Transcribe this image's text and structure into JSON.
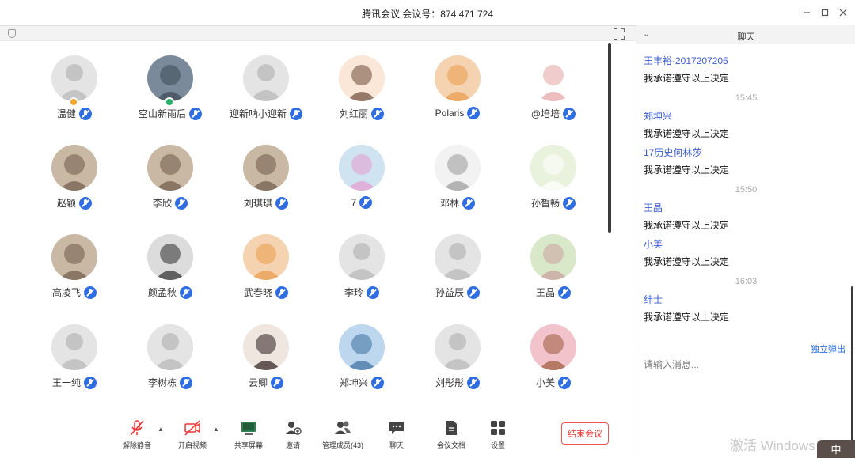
{
  "window": {
    "title": "腾讯会议 会议号：874 471 724",
    "controls": [
      "minimize-icon",
      "maximize-icon",
      "close-icon"
    ]
  },
  "participants": [
    {
      "name": "温健",
      "avatar": "default-avatar",
      "badge": "host"
    },
    {
      "name": "空山新雨后",
      "avatar": "city-photo",
      "badge": "green"
    },
    {
      "name": "迎新呐小迎新",
      "avatar": "default-avatar"
    },
    {
      "name": "刘红丽",
      "avatar": "cartoon-kid"
    },
    {
      "name": "Polaris",
      "avatar": "anime-girl"
    },
    {
      "name": "@培培",
      "avatar": "cartoon-sketch"
    },
    {
      "name": "赵颖",
      "avatar": "cat-photo"
    },
    {
      "name": "李欣",
      "avatar": "cat-photo"
    },
    {
      "name": "刘琪琪",
      "avatar": "cat-photo"
    },
    {
      "name": "7",
      "avatar": "cartoon-pink"
    },
    {
      "name": "邓林",
      "avatar": "cartoon-mouse"
    },
    {
      "name": "孙皙畅",
      "avatar": "cartoon-fluffy"
    },
    {
      "name": "高凌飞",
      "avatar": "cat-photo"
    },
    {
      "name": "颜孟秋",
      "avatar": "person-mask"
    },
    {
      "name": "武春晓",
      "avatar": "anime-girl"
    },
    {
      "name": "李玲",
      "avatar": "default-avatar"
    },
    {
      "name": "孙益辰",
      "avatar": "default-avatar"
    },
    {
      "name": "王晶",
      "avatar": "anime-green"
    },
    {
      "name": "王一纯",
      "avatar": "default-avatar"
    },
    {
      "name": "李树栋",
      "avatar": "default-avatar"
    },
    {
      "name": "云卿",
      "avatar": "anime-dark-hair"
    },
    {
      "name": "郑坤兴",
      "avatar": "person-sky"
    },
    {
      "name": "刘彤彤",
      "avatar": "default-avatar"
    },
    {
      "name": "小美",
      "avatar": "anime-flowers"
    }
  ],
  "toolbar": {
    "items": [
      {
        "label": "解除静音",
        "icon": "mic-muted-icon"
      },
      {
        "label": "开启视频",
        "icon": "camera-off-icon"
      },
      {
        "label": "共享屏幕",
        "icon": "share-screen-icon"
      },
      {
        "label": "邀请",
        "icon": "invite-icon"
      },
      {
        "label": "管理成员(43)",
        "icon": "members-icon"
      },
      {
        "label": "聊天",
        "icon": "chat-icon"
      },
      {
        "label": "会议文档",
        "icon": "document-icon"
      },
      {
        "label": "设置",
        "icon": "settings-icon"
      }
    ],
    "end_label": "结束会议"
  },
  "chat": {
    "title": "聊天",
    "messages": [
      {
        "sender": "王丰裕-2017207205",
        "text": "我承诺遵守以上决定"
      },
      {
        "time": "15:45"
      },
      {
        "sender": "郑坤兴",
        "text": "我承诺遵守以上决定"
      },
      {
        "sender": "17历史何林莎",
        "text": "我承诺遵守以上决定"
      },
      {
        "time": "15:50"
      },
      {
        "sender": "王晶",
        "text": "我承诺遵守以上决定"
      },
      {
        "sender": "小美",
        "text": "我承诺遵守以上决定"
      },
      {
        "time": "16:03"
      },
      {
        "sender": "绅士",
        "text": "我承诺遵守以上决定"
      }
    ],
    "popout_label": "独立弹出",
    "input_placeholder": "请输入消息..."
  },
  "system": {
    "watermark": "激活 Windows",
    "ime": "中"
  },
  "colors": {
    "accent": "#2f6de2",
    "chat_sender": "#3a5bcc",
    "end_button": "#e33333"
  }
}
